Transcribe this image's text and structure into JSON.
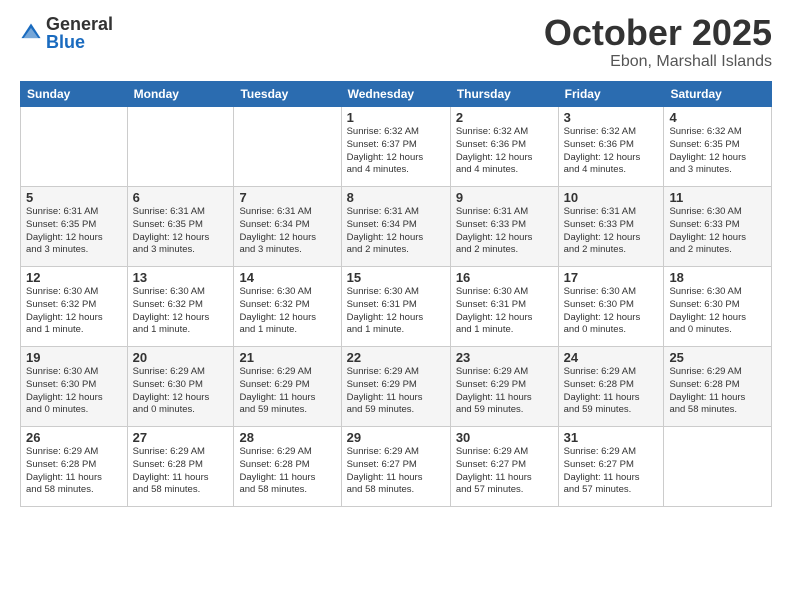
{
  "header": {
    "logo_general": "General",
    "logo_blue": "Blue",
    "month_title": "October 2025",
    "location": "Ebon, Marshall Islands"
  },
  "days_of_week": [
    "Sunday",
    "Monday",
    "Tuesday",
    "Wednesday",
    "Thursday",
    "Friday",
    "Saturday"
  ],
  "weeks": [
    [
      {
        "day": "",
        "info": ""
      },
      {
        "day": "",
        "info": ""
      },
      {
        "day": "",
        "info": ""
      },
      {
        "day": "1",
        "info": "Sunrise: 6:32 AM\nSunset: 6:37 PM\nDaylight: 12 hours\nand 4 minutes."
      },
      {
        "day": "2",
        "info": "Sunrise: 6:32 AM\nSunset: 6:36 PM\nDaylight: 12 hours\nand 4 minutes."
      },
      {
        "day": "3",
        "info": "Sunrise: 6:32 AM\nSunset: 6:36 PM\nDaylight: 12 hours\nand 4 minutes."
      },
      {
        "day": "4",
        "info": "Sunrise: 6:32 AM\nSunset: 6:35 PM\nDaylight: 12 hours\nand 3 minutes."
      }
    ],
    [
      {
        "day": "5",
        "info": "Sunrise: 6:31 AM\nSunset: 6:35 PM\nDaylight: 12 hours\nand 3 minutes."
      },
      {
        "day": "6",
        "info": "Sunrise: 6:31 AM\nSunset: 6:35 PM\nDaylight: 12 hours\nand 3 minutes."
      },
      {
        "day": "7",
        "info": "Sunrise: 6:31 AM\nSunset: 6:34 PM\nDaylight: 12 hours\nand 3 minutes."
      },
      {
        "day": "8",
        "info": "Sunrise: 6:31 AM\nSunset: 6:34 PM\nDaylight: 12 hours\nand 2 minutes."
      },
      {
        "day": "9",
        "info": "Sunrise: 6:31 AM\nSunset: 6:33 PM\nDaylight: 12 hours\nand 2 minutes."
      },
      {
        "day": "10",
        "info": "Sunrise: 6:31 AM\nSunset: 6:33 PM\nDaylight: 12 hours\nand 2 minutes."
      },
      {
        "day": "11",
        "info": "Sunrise: 6:30 AM\nSunset: 6:33 PM\nDaylight: 12 hours\nand 2 minutes."
      }
    ],
    [
      {
        "day": "12",
        "info": "Sunrise: 6:30 AM\nSunset: 6:32 PM\nDaylight: 12 hours\nand 1 minute."
      },
      {
        "day": "13",
        "info": "Sunrise: 6:30 AM\nSunset: 6:32 PM\nDaylight: 12 hours\nand 1 minute."
      },
      {
        "day": "14",
        "info": "Sunrise: 6:30 AM\nSunset: 6:32 PM\nDaylight: 12 hours\nand 1 minute."
      },
      {
        "day": "15",
        "info": "Sunrise: 6:30 AM\nSunset: 6:31 PM\nDaylight: 12 hours\nand 1 minute."
      },
      {
        "day": "16",
        "info": "Sunrise: 6:30 AM\nSunset: 6:31 PM\nDaylight: 12 hours\nand 1 minute."
      },
      {
        "day": "17",
        "info": "Sunrise: 6:30 AM\nSunset: 6:30 PM\nDaylight: 12 hours\nand 0 minutes."
      },
      {
        "day": "18",
        "info": "Sunrise: 6:30 AM\nSunset: 6:30 PM\nDaylight: 12 hours\nand 0 minutes."
      }
    ],
    [
      {
        "day": "19",
        "info": "Sunrise: 6:30 AM\nSunset: 6:30 PM\nDaylight: 12 hours\nand 0 minutes."
      },
      {
        "day": "20",
        "info": "Sunrise: 6:29 AM\nSunset: 6:30 PM\nDaylight: 12 hours\nand 0 minutes."
      },
      {
        "day": "21",
        "info": "Sunrise: 6:29 AM\nSunset: 6:29 PM\nDaylight: 11 hours\nand 59 minutes."
      },
      {
        "day": "22",
        "info": "Sunrise: 6:29 AM\nSunset: 6:29 PM\nDaylight: 11 hours\nand 59 minutes."
      },
      {
        "day": "23",
        "info": "Sunrise: 6:29 AM\nSunset: 6:29 PM\nDaylight: 11 hours\nand 59 minutes."
      },
      {
        "day": "24",
        "info": "Sunrise: 6:29 AM\nSunset: 6:28 PM\nDaylight: 11 hours\nand 59 minutes."
      },
      {
        "day": "25",
        "info": "Sunrise: 6:29 AM\nSunset: 6:28 PM\nDaylight: 11 hours\nand 58 minutes."
      }
    ],
    [
      {
        "day": "26",
        "info": "Sunrise: 6:29 AM\nSunset: 6:28 PM\nDaylight: 11 hours\nand 58 minutes."
      },
      {
        "day": "27",
        "info": "Sunrise: 6:29 AM\nSunset: 6:28 PM\nDaylight: 11 hours\nand 58 minutes."
      },
      {
        "day": "28",
        "info": "Sunrise: 6:29 AM\nSunset: 6:28 PM\nDaylight: 11 hours\nand 58 minutes."
      },
      {
        "day": "29",
        "info": "Sunrise: 6:29 AM\nSunset: 6:27 PM\nDaylight: 11 hours\nand 58 minutes."
      },
      {
        "day": "30",
        "info": "Sunrise: 6:29 AM\nSunset: 6:27 PM\nDaylight: 11 hours\nand 57 minutes."
      },
      {
        "day": "31",
        "info": "Sunrise: 6:29 AM\nSunset: 6:27 PM\nDaylight: 11 hours\nand 57 minutes."
      },
      {
        "day": "",
        "info": ""
      }
    ]
  ]
}
